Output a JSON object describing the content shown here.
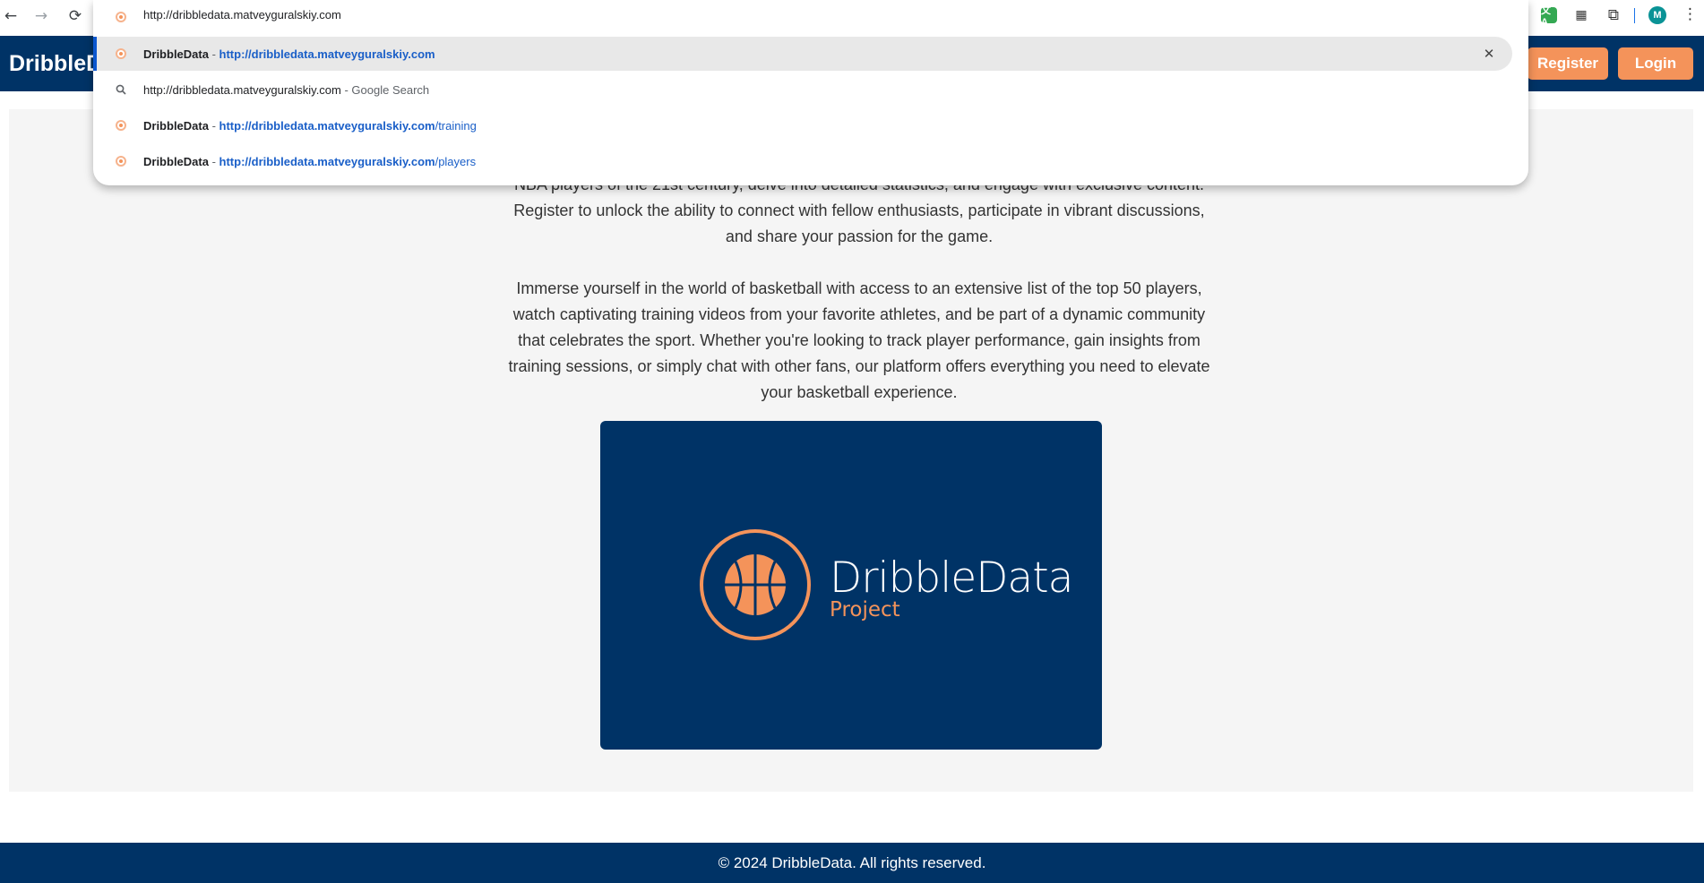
{
  "browser": {
    "address_value": "http://dribbledata.matveyguralskiy.com",
    "nav": {
      "back_icon": "←",
      "forward_icon": "→",
      "reload_icon": "⟳"
    },
    "extensions": {
      "translate_label": "文A",
      "qr_icon": "▦",
      "puzzle_icon": "⧉",
      "avatar_initial": "M",
      "menu_icon": "⋮"
    }
  },
  "omnibox": {
    "suggestions": [
      {
        "title": "DribbleData",
        "sep": " - ",
        "url": "http://dribbledata.matveyguralskiy.com",
        "path": "",
        "close": "✕"
      },
      {
        "query": "http://dribbledata.matveyguralskiy.com",
        "hint": " - Google Search"
      },
      {
        "title": "DribbleData",
        "sep": " - ",
        "url": "http://dribbledata.matveyguralskiy.com",
        "path": "/training"
      },
      {
        "title": "DribbleData",
        "sep": " - ",
        "url": "http://dribbledata.matveyguralskiy.com",
        "path": "/players"
      }
    ]
  },
  "site": {
    "logo": "DribbleData",
    "register_label": "Register",
    "login_label": "Login",
    "intro_paragraph_1": "NBA players of the 21st century, delve into detailed statistics, and engage with exclusive content. Register to unlock the ability to connect with fellow enthusiasts, participate in vibrant discussions, and share your passion for the game.",
    "intro_paragraph_2": "Immerse yourself in the world of basketball with access to an extensive list of the top 50 players, watch captivating training videos from your favorite athletes, and be part of a dynamic community that celebrates the sport. Whether you're looking to track player performance, gain insights from training sessions, or simply chat with other fans, our platform offers everything you need to elevate your basketball experience.",
    "hero_title": "DribbleData",
    "hero_subtitle": "Project",
    "footer": "© 2024 DribbleData. All rights reserved."
  },
  "colors": {
    "navy": "#003366",
    "orange": "#f4935a",
    "panel": "#f5f5f5"
  }
}
